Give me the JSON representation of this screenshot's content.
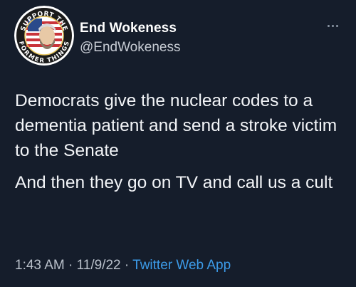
{
  "tweet": {
    "author": {
      "display_name": "End Wokeness",
      "handle": "@EndWokeness",
      "avatar": {
        "icon": "avatar-badge-icon",
        "badge_text_top": "SUPPORT THE",
        "badge_text_bottom": "FORMER THINGS"
      }
    },
    "more_icon": "more-options-icon",
    "paragraphs": [
      "Democrats give the nuclear codes to a dementia patient and send a stroke victim to the Senate",
      "And then they go on TV and call us a cult"
    ],
    "meta": {
      "time": "1:43 AM",
      "separator": "·",
      "date": "11/9/22",
      "source": "Twitter Web App"
    },
    "colors": {
      "background": "#151d2b",
      "text": "#f2f4f7",
      "secondary_text": "#b9c0ca",
      "link": "#3c9be8"
    }
  }
}
